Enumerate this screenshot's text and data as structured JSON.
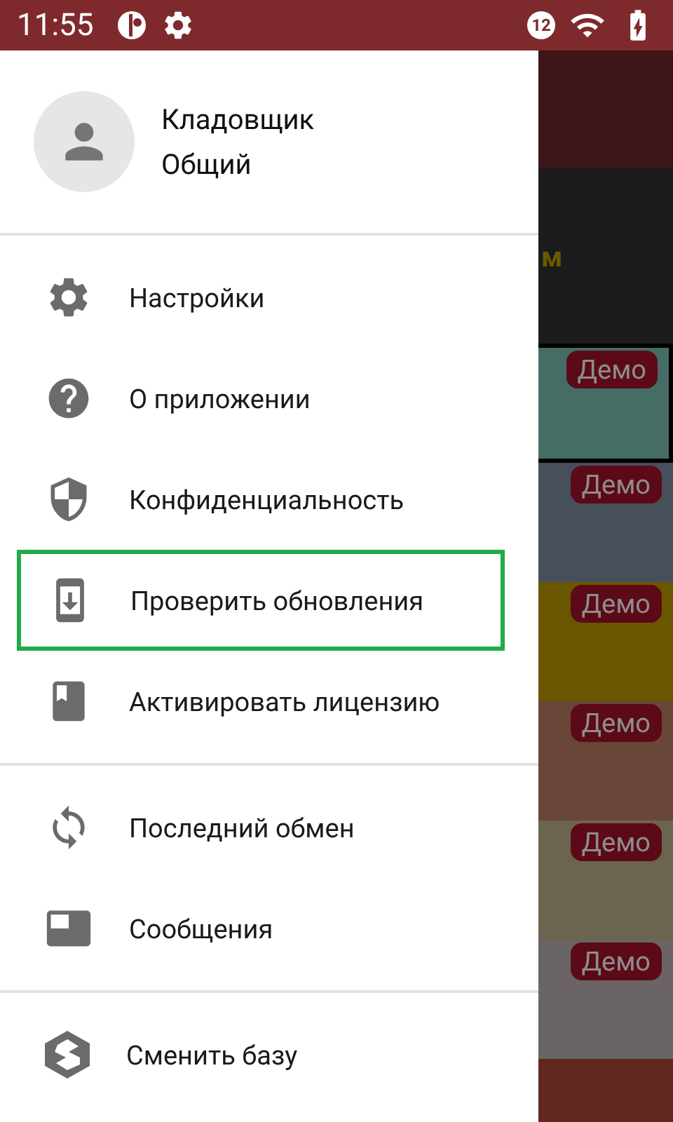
{
  "status_bar": {
    "time": "11:55",
    "notification_count": "12"
  },
  "drawer": {
    "user": {
      "name": "Кладовщик",
      "role": "Общий"
    },
    "groups": [
      {
        "items": [
          {
            "label": "Настройки",
            "selected": false
          },
          {
            "label": "О приложении",
            "selected": false
          },
          {
            "label": "Конфиденциальность",
            "selected": false
          },
          {
            "label": "Проверить обновления",
            "selected": true
          },
          {
            "label": "Активировать лицензию",
            "selected": false
          }
        ]
      },
      {
        "items": [
          {
            "label": "Последний обмен",
            "selected": false
          },
          {
            "label": "Сообщения",
            "selected": false
          }
        ]
      },
      {
        "items": [
          {
            "label": "Сменить базу",
            "selected": false
          }
        ]
      }
    ]
  },
  "background": {
    "heading_fragment": "м",
    "tiles": [
      {
        "badge": "Демо",
        "color": "#466c66"
      },
      {
        "badge": "Демо",
        "color": "#474f5a"
      },
      {
        "badge": "Демо",
        "color": "#6b5600"
      },
      {
        "badge": "Демо",
        "color": "#684638"
      },
      {
        "badge": "Демо",
        "color": "#6b644f"
      },
      {
        "badge": "Демо",
        "color": "#6a6464"
      }
    ]
  }
}
